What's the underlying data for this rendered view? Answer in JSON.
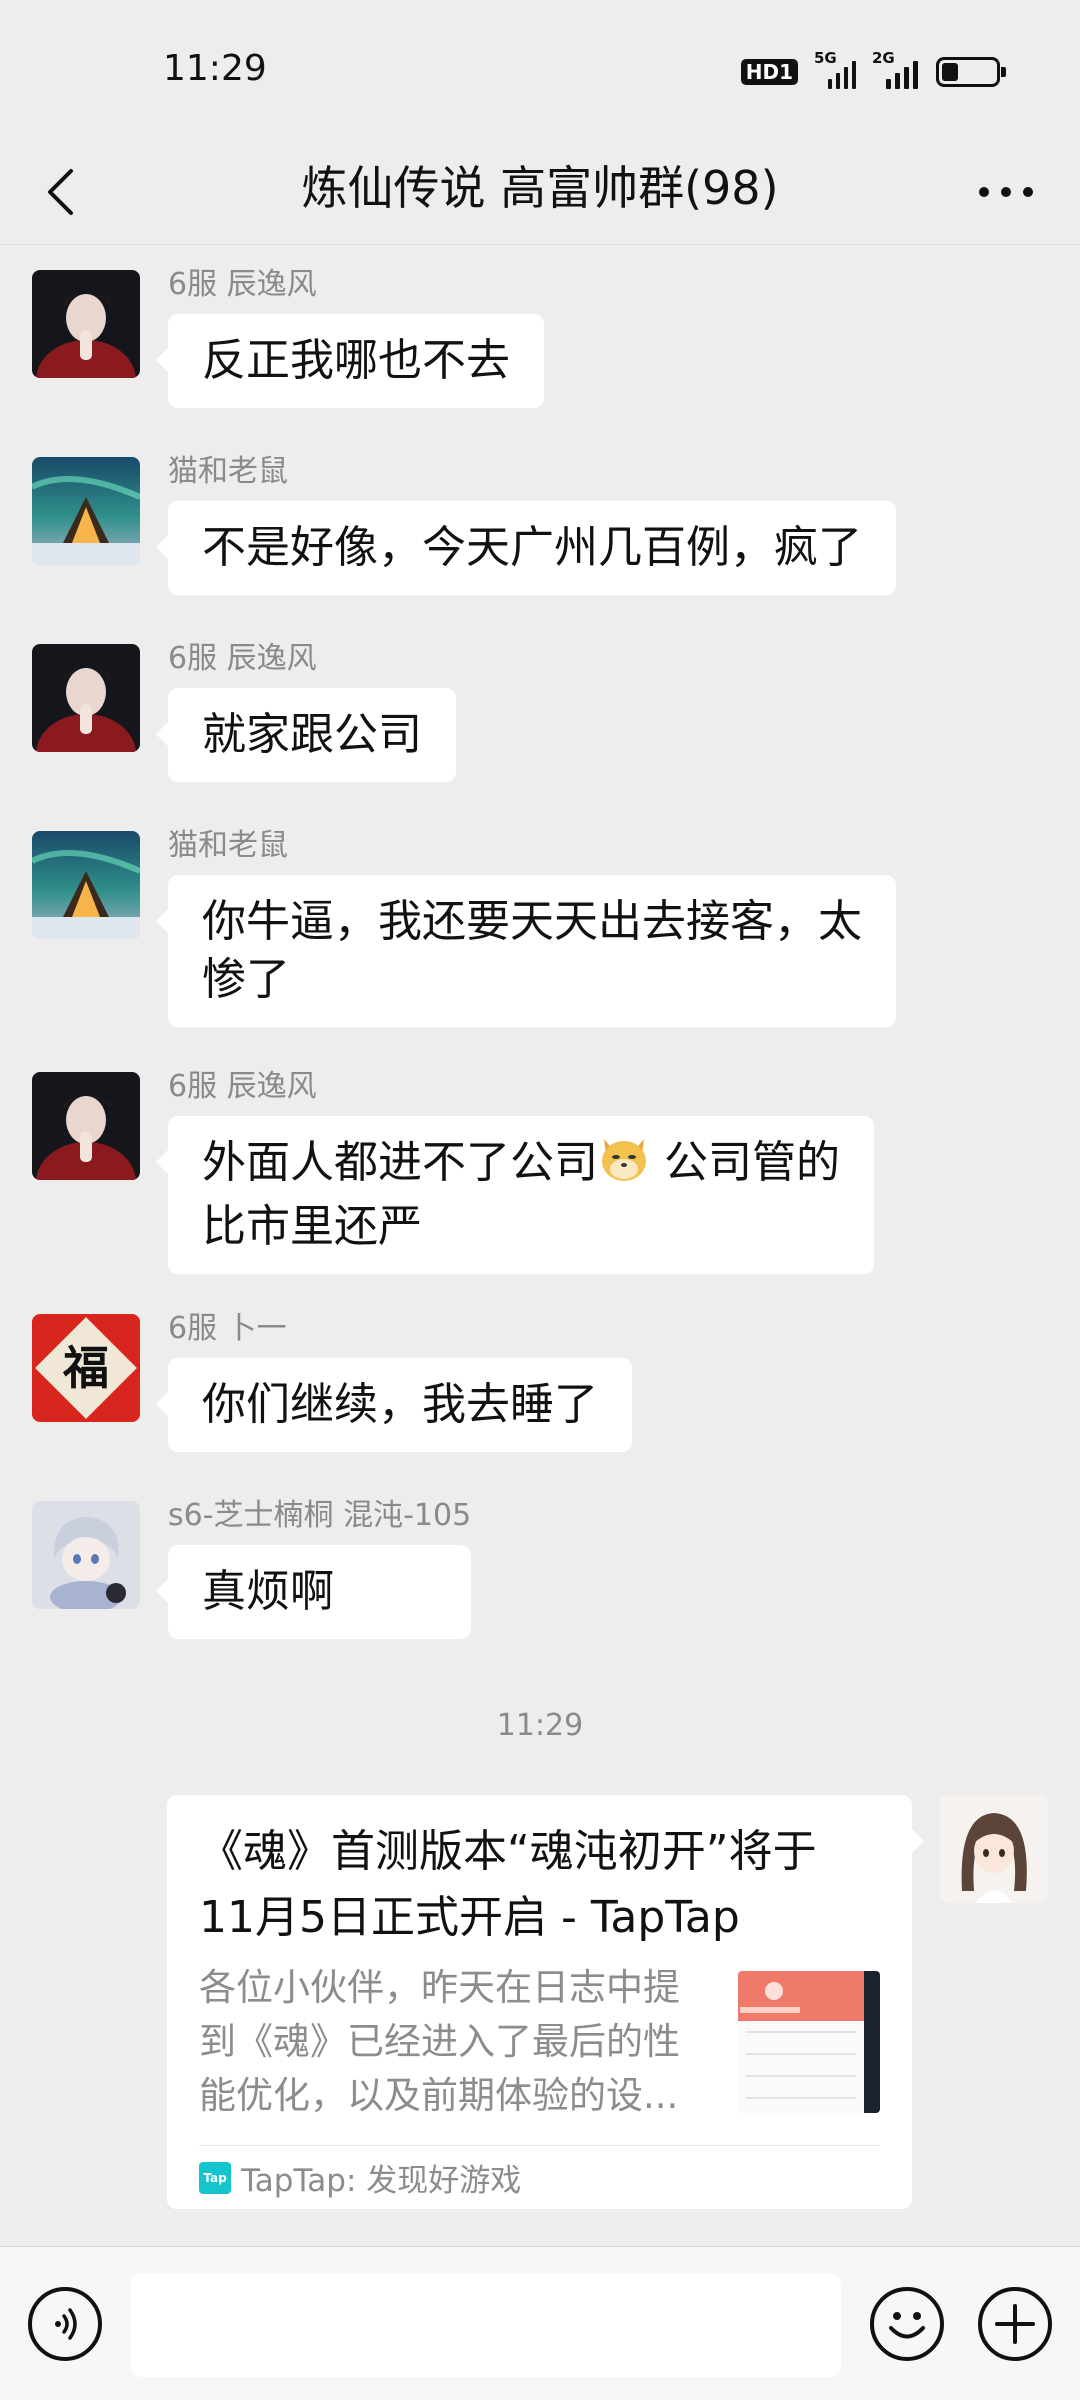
{
  "status_bar": {
    "time": "11:29",
    "hd_label": "HD1",
    "network_1": "5G",
    "network_2": "2G",
    "battery_level": 0.3
  },
  "header": {
    "title": "炼仙传说 高富帅群(98)"
  },
  "messages": [
    {
      "sender": "6服 辰逸风",
      "text": "反正我哪也不去",
      "avatar": "avatar-boy-red"
    },
    {
      "sender": "猫和老鼠",
      "text": "不是好像，今天广州几百例，疯了",
      "avatar": "avatar-aurora-cabin"
    },
    {
      "sender": "6服 辰逸风",
      "text": "就家跟公司",
      "avatar": "avatar-boy-red"
    },
    {
      "sender": "猫和老鼠",
      "text_line1": "你牛逼，我还要天天出去接客，太",
      "text_line2": "惨了",
      "avatar": "avatar-aurora-cabin"
    },
    {
      "sender": "6服 辰逸风",
      "text_part1": "外面人都进不了公司",
      "emoji": "doge-emoji",
      "text_part2": " 公司管的",
      "text_line2": "比市里还严",
      "avatar": "avatar-boy-red"
    },
    {
      "sender": "6服 卜一",
      "text": "你们继续，我去睡了",
      "avatar": "avatar-red-seal"
    },
    {
      "sender": "s6-芝士楠桐 混沌-105",
      "text": "真烦啊",
      "avatar": "avatar-anime-silver"
    }
  ],
  "timestamp": "11:29",
  "share_card": {
    "title_line1": "《魂》首测版本“魂沌初开”将于",
    "title_line2": "11月5日正式开启 - TapTap",
    "desc_line1": "各位小伙伴，昨天在日志中提",
    "desc_line2": "到《魂》已经进入了最后的性",
    "desc_line3": "能优化，以及前期体验的设...",
    "source_logo_text": "Tap",
    "source": "TapTap: 发现好游戏",
    "avatar": "avatar-anime-girl"
  },
  "input_bar": {
    "value": "",
    "voice_icon": "voice-icon",
    "emoji_icon": "emoji-icon",
    "plus_icon": "plus-icon"
  },
  "colors": {
    "background": "#ededed",
    "bubble": "#ffffff",
    "meta_text": "#8a8a8a",
    "taptap": "#15c5ce"
  }
}
